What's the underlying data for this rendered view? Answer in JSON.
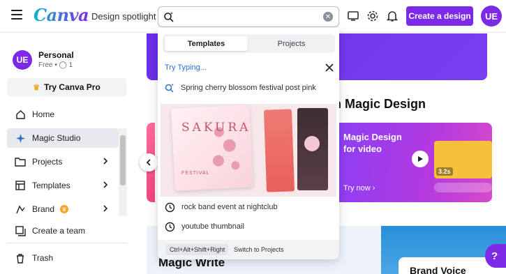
{
  "topbar": {
    "logo": "Canva",
    "spotlight_label": "Design spotlight",
    "create_label": "Create a design",
    "avatar_initials": "UE"
  },
  "sidebar": {
    "account": {
      "initials": "UE",
      "name": "Personal",
      "plan": "Free •",
      "members": "1"
    },
    "try_pro_label": "Try Canva Pro",
    "items": [
      {
        "label": "Home",
        "icon": "home-icon"
      },
      {
        "label": "Magic Studio",
        "icon": "sparkle-icon",
        "active": true
      },
      {
        "label": "Projects",
        "icon": "folder-icon"
      },
      {
        "label": "Templates",
        "icon": "templates-icon"
      },
      {
        "label": "Brand",
        "icon": "brand-icon"
      },
      {
        "label": "Create a team",
        "icon": "team-icon"
      },
      {
        "label": "Trash",
        "icon": "trash-icon"
      }
    ]
  },
  "main": {
    "section_heading": "th Magic Design",
    "video_card": {
      "title": "Magic Design for video",
      "try_label": "Try now",
      "time": "3.2s"
    },
    "magic_write": "Magic Write",
    "brand_voice": "Brand Voice",
    "help": "?"
  },
  "search": {
    "value": "",
    "tabs": [
      {
        "label": "Templates",
        "active": true
      },
      {
        "label": "Projects",
        "active": false
      }
    ],
    "try_typing": "Try Typing...",
    "magic_suggestion": "Spring cherry blossom festival post pink",
    "recent": [
      "rock band event at nightclub",
      "youtube thumbnail"
    ],
    "preview": {
      "title": "SAKURA",
      "subtitle": "FESTIVAL"
    },
    "shortcut": "Ctrl+Alt+Shift+Right",
    "shortcut_hint": "Switch to Projects"
  },
  "colors": {
    "accent": "#7d2ae8",
    "link": "#2a6fd6"
  }
}
